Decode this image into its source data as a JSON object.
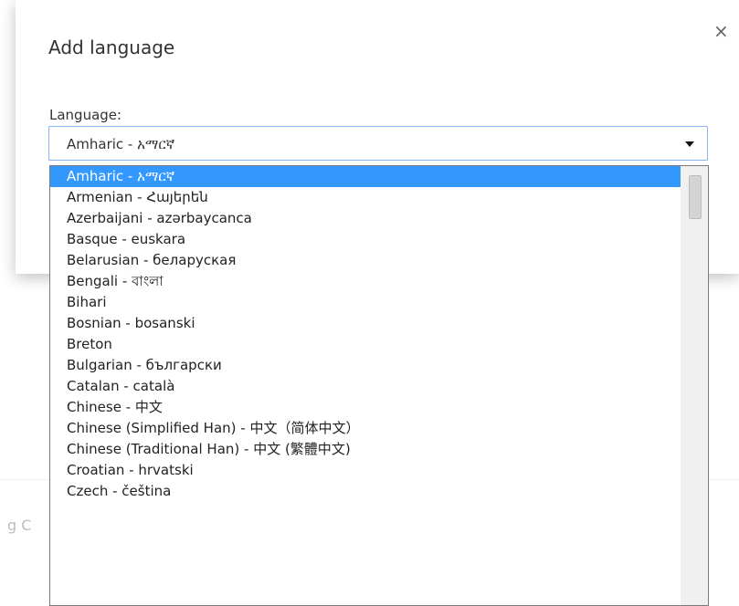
{
  "background": {
    "snippet_text": "g C"
  },
  "dialog": {
    "title": "Add language",
    "close_label": "×",
    "language_label": "Language:",
    "selected_value": "Amharic - አማርኛ",
    "options": [
      {
        "label": "Amharic - አማርኛ",
        "selected": true
      },
      {
        "label": "Armenian - Հայերեն",
        "selected": false
      },
      {
        "label": "Azerbaijani - azərbaycanca",
        "selected": false
      },
      {
        "label": "Basque - euskara",
        "selected": false
      },
      {
        "label": "Belarusian - беларуская",
        "selected": false
      },
      {
        "label": "Bengali - বাংলা",
        "selected": false
      },
      {
        "label": "Bihari",
        "selected": false
      },
      {
        "label": "Bosnian - bosanski",
        "selected": false
      },
      {
        "label": "Breton",
        "selected": false
      },
      {
        "label": "Bulgarian - български",
        "selected": false
      },
      {
        "label": "Catalan - català",
        "selected": false
      },
      {
        "label": "Chinese - 中文",
        "selected": false
      },
      {
        "label": "Chinese (Simplified Han) - 中文（简体中文）",
        "selected": false
      },
      {
        "label": "Chinese (Traditional Han) - 中文 (繁體中文)",
        "selected": false
      },
      {
        "label": "Croatian - hrvatski",
        "selected": false
      },
      {
        "label": "Czech - čeština",
        "selected": false
      }
    ]
  },
  "colors": {
    "selection_bg": "#3399ff",
    "select_border": "#8ab4f8"
  },
  "icons": {
    "close": "close-icon",
    "dropdown": "dropdown-arrow-icon"
  }
}
